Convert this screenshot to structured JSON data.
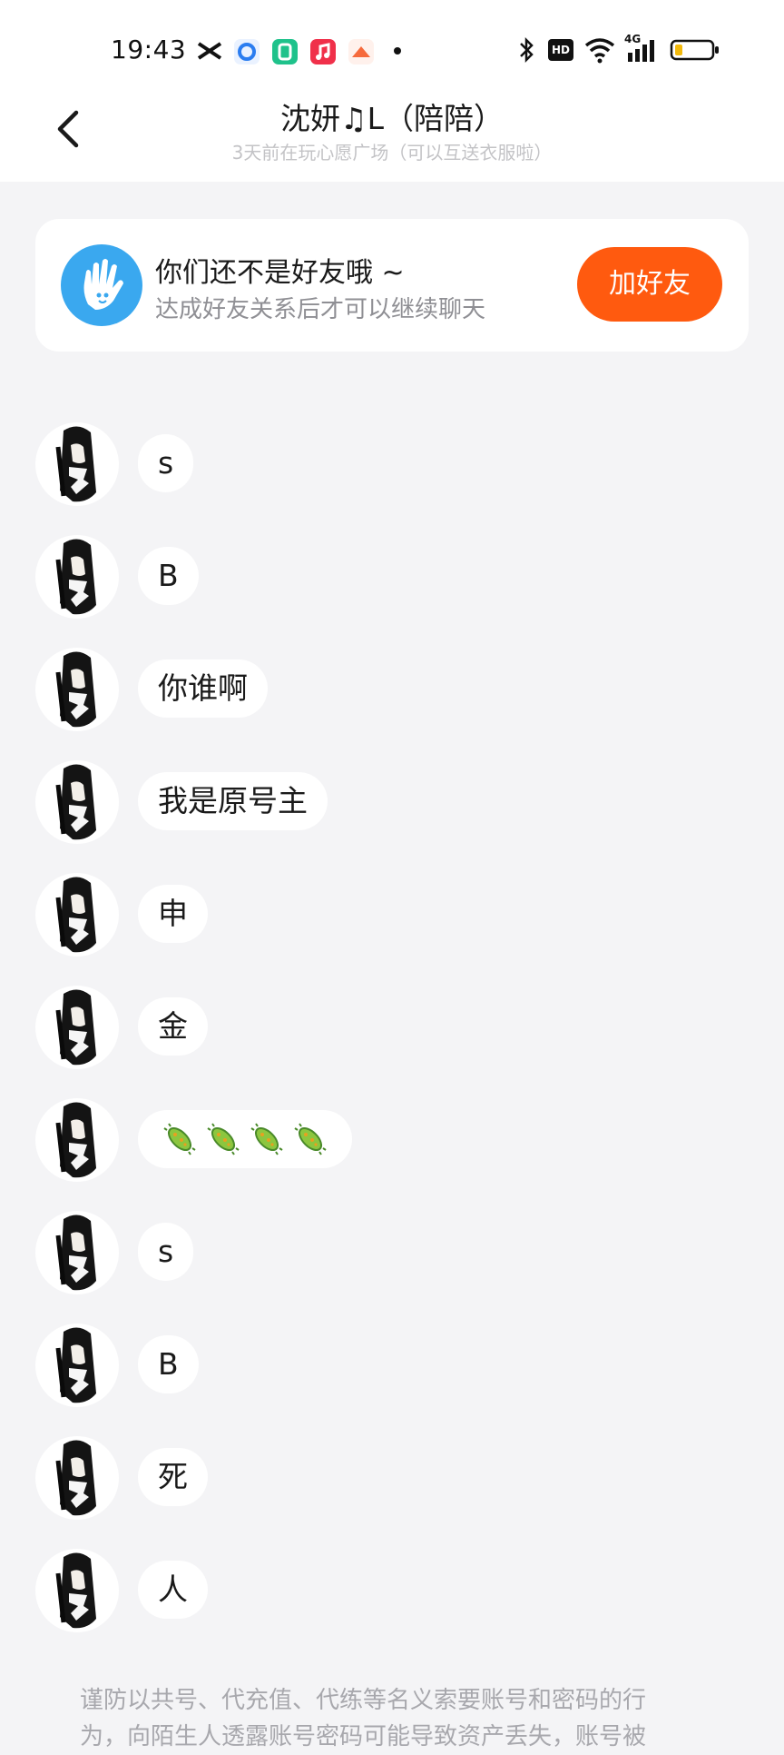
{
  "status_bar": {
    "time": "19:43",
    "hd_label": "HD",
    "network_label": "4G"
  },
  "header": {
    "title": "沈妍♫L（陪陪）",
    "subtitle": "3天前在玩心愿广场（可以互送衣服啦）"
  },
  "friend_card": {
    "title": "你们还不是好友哦 ~",
    "subtitle": "达成好友关系后才可以继续聊天",
    "button_label": "加好友"
  },
  "messages": [
    {
      "text": "s"
    },
    {
      "text": "B"
    },
    {
      "text": "你谁啊"
    },
    {
      "text": "我是原号主"
    },
    {
      "text": "申"
    },
    {
      "text": "金"
    },
    {
      "text": "",
      "emoji": [
        "microbe",
        "microbe",
        "microbe",
        "microbe"
      ]
    },
    {
      "text": "s"
    },
    {
      "text": "B"
    },
    {
      "text": "死"
    },
    {
      "text": "人"
    }
  ],
  "notice": {
    "line1": "谨防以共号、代充值、代练等名义索要账号和密码的行",
    "line2": "为，向陌生人透露账号密码可能导致资产丢失，账号被"
  },
  "colors": {
    "accent": "#ff5a0f",
    "background": "#f4f4f6",
    "card_icon": "#3aa8ef"
  }
}
